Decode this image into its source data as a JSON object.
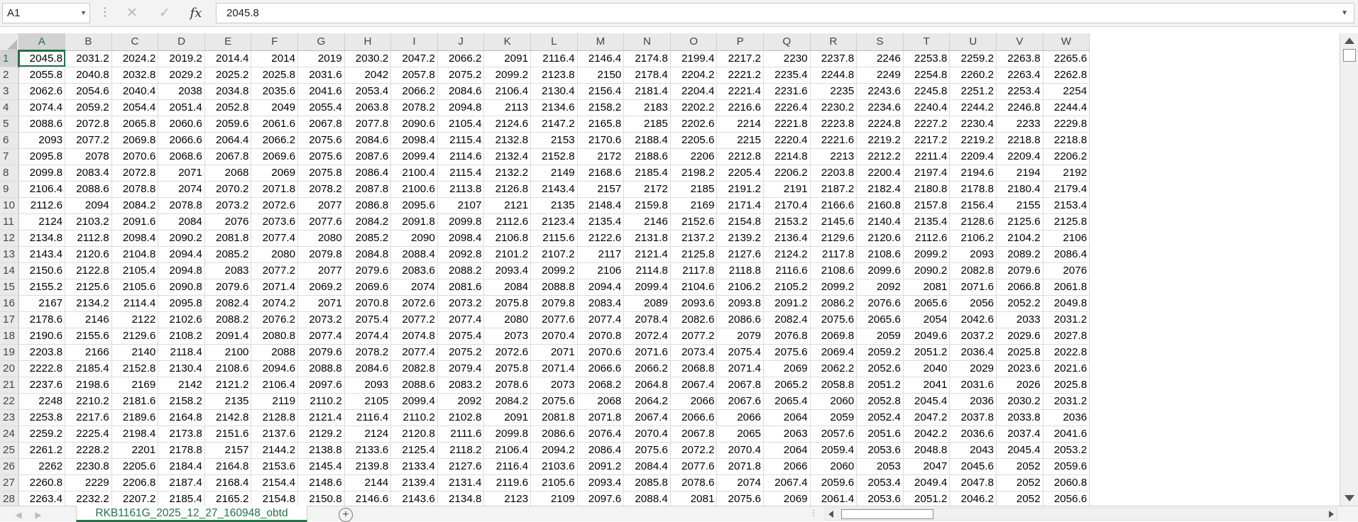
{
  "formula_bar": {
    "name_box": "A1",
    "formula_value": "2045.8",
    "cancel_icon": "close-icon",
    "enter_icon": "check-icon",
    "function_label": "fx"
  },
  "sheet": {
    "columns": [
      "A",
      "B",
      "C",
      "D",
      "E",
      "F",
      "G",
      "H",
      "I",
      "J",
      "K",
      "L",
      "M",
      "N",
      "O",
      "P",
      "Q",
      "R",
      "S",
      "T",
      "U",
      "V",
      "W"
    ],
    "selected_column": "A",
    "selected_row": 1,
    "rows": [
      {
        "n": "1",
        "cells": [
          "2045.8",
          "2031.2",
          "2024.2",
          "2019.2",
          "2014.4",
          "2014",
          "2019",
          "2030.2",
          "2047.2",
          "2066.2",
          "2091",
          "2116.4",
          "2146.4",
          "2174.8",
          "2199.4",
          "2217.2",
          "2230",
          "2237.8",
          "2246",
          "2253.8",
          "2259.2",
          "2263.8",
          "2265.6"
        ]
      },
      {
        "n": "2",
        "cells": [
          "2055.8",
          "2040.8",
          "2032.8",
          "2029.2",
          "2025.2",
          "2025.8",
          "2031.6",
          "2042",
          "2057.8",
          "2075.2",
          "2099.2",
          "2123.8",
          "2150",
          "2178.4",
          "2204.2",
          "2221.2",
          "2235.4",
          "2244.8",
          "2249",
          "2254.8",
          "2260.2",
          "2263.4",
          "2262.8"
        ]
      },
      {
        "n": "3",
        "cells": [
          "2062.6",
          "2054.6",
          "2040.4",
          "2038",
          "2034.8",
          "2035.6",
          "2041.6",
          "2053.4",
          "2066.2",
          "2084.6",
          "2106.4",
          "2130.4",
          "2156.4",
          "2181.4",
          "2204.4",
          "2221.4",
          "2231.6",
          "2235",
          "2243.6",
          "2245.8",
          "2251.2",
          "2253.4",
          "2254"
        ]
      },
      {
        "n": "4",
        "cells": [
          "2074.4",
          "2059.2",
          "2054.4",
          "2051.4",
          "2052.8",
          "2049",
          "2055.4",
          "2063.8",
          "2078.2",
          "2094.8",
          "2113",
          "2134.6",
          "2158.2",
          "2183",
          "2202.2",
          "2216.6",
          "2226.4",
          "2230.2",
          "2234.6",
          "2240.4",
          "2244.2",
          "2246.8",
          "2244.4"
        ]
      },
      {
        "n": "5",
        "cells": [
          "2088.6",
          "2072.8",
          "2065.8",
          "2060.6",
          "2059.6",
          "2061.6",
          "2067.8",
          "2077.8",
          "2090.6",
          "2105.4",
          "2124.6",
          "2147.2",
          "2165.8",
          "2185",
          "2202.6",
          "2214",
          "2221.8",
          "2223.8",
          "2224.8",
          "2227.2",
          "2230.4",
          "2233",
          "2229.8"
        ]
      },
      {
        "n": "6",
        "cells": [
          "2093",
          "2077.2",
          "2069.8",
          "2066.6",
          "2064.4",
          "2066.2",
          "2075.6",
          "2084.6",
          "2098.4",
          "2115.4",
          "2132.8",
          "2153",
          "2170.6",
          "2188.4",
          "2205.6",
          "2215",
          "2220.4",
          "2221.6",
          "2219.2",
          "2217.2",
          "2219.2",
          "2218.8",
          "2218.8"
        ]
      },
      {
        "n": "7",
        "cells": [
          "2095.8",
          "2078",
          "2070.6",
          "2068.6",
          "2067.8",
          "2069.6",
          "2075.6",
          "2087.6",
          "2099.4",
          "2114.6",
          "2132.4",
          "2152.8",
          "2172",
          "2188.6",
          "2206",
          "2212.8",
          "2214.8",
          "2213",
          "2212.2",
          "2211.4",
          "2209.4",
          "2209.4",
          "2206.2"
        ]
      },
      {
        "n": "8",
        "cells": [
          "2099.8",
          "2083.4",
          "2072.8",
          "2071",
          "2068",
          "2069",
          "2075.8",
          "2086.4",
          "2100.4",
          "2115.4",
          "2132.2",
          "2149",
          "2168.6",
          "2185.4",
          "2198.2",
          "2205.4",
          "2206.2",
          "2203.8",
          "2200.4",
          "2197.4",
          "2194.6",
          "2194",
          "2192"
        ]
      },
      {
        "n": "9",
        "cells": [
          "2106.4",
          "2088.6",
          "2078.8",
          "2074",
          "2070.2",
          "2071.8",
          "2078.2",
          "2087.8",
          "2100.6",
          "2113.8",
          "2126.8",
          "2143.4",
          "2157",
          "2172",
          "2185",
          "2191.2",
          "2191",
          "2187.2",
          "2182.4",
          "2180.8",
          "2178.8",
          "2180.4",
          "2179.4"
        ]
      },
      {
        "n": "10",
        "cells": [
          "2112.6",
          "2094",
          "2084.2",
          "2078.8",
          "2073.2",
          "2072.6",
          "2077",
          "2086.8",
          "2095.6",
          "2107",
          "2121",
          "2135",
          "2148.4",
          "2159.8",
          "2169",
          "2171.4",
          "2170.4",
          "2166.6",
          "2160.8",
          "2157.8",
          "2156.4",
          "2155",
          "2153.4"
        ]
      },
      {
        "n": "11",
        "cells": [
          "2124",
          "2103.2",
          "2091.6",
          "2084",
          "2076",
          "2073.6",
          "2077.6",
          "2084.2",
          "2091.8",
          "2099.8",
          "2112.6",
          "2123.4",
          "2135.4",
          "2146",
          "2152.6",
          "2154.8",
          "2153.2",
          "2145.6",
          "2140.4",
          "2135.4",
          "2128.6",
          "2125.6",
          "2125.8"
        ]
      },
      {
        "n": "12",
        "cells": [
          "2134.8",
          "2112.8",
          "2098.4",
          "2090.2",
          "2081.8",
          "2077.4",
          "2080",
          "2085.2",
          "2090",
          "2098.4",
          "2106.8",
          "2115.6",
          "2122.6",
          "2131.8",
          "2137.2",
          "2139.2",
          "2136.4",
          "2129.6",
          "2120.6",
          "2112.6",
          "2106.2",
          "2104.2",
          "2106"
        ]
      },
      {
        "n": "13",
        "cells": [
          "2143.4",
          "2120.6",
          "2104.8",
          "2094.4",
          "2085.2",
          "2080",
          "2079.8",
          "2084.8",
          "2088.4",
          "2092.8",
          "2101.2",
          "2107.2",
          "2117",
          "2121.4",
          "2125.8",
          "2127.6",
          "2124.2",
          "2117.8",
          "2108.6",
          "2099.2",
          "2093",
          "2089.2",
          "2086.4"
        ]
      },
      {
        "n": "14",
        "cells": [
          "2150.6",
          "2122.8",
          "2105.4",
          "2094.8",
          "2083",
          "2077.2",
          "2077",
          "2079.6",
          "2083.6",
          "2088.2",
          "2093.4",
          "2099.2",
          "2106",
          "2114.8",
          "2117.8",
          "2118.8",
          "2116.6",
          "2108.6",
          "2099.6",
          "2090.2",
          "2082.8",
          "2079.6",
          "2076"
        ]
      },
      {
        "n": "15",
        "cells": [
          "2155.2",
          "2125.6",
          "2105.6",
          "2090.8",
          "2079.6",
          "2071.4",
          "2069.2",
          "2069.6",
          "2074",
          "2081.6",
          "2084",
          "2088.8",
          "2094.4",
          "2099.4",
          "2104.6",
          "2106.2",
          "2105.2",
          "2099.2",
          "2092",
          "2081",
          "2071.6",
          "2066.8",
          "2061.8"
        ]
      },
      {
        "n": "16",
        "cells": [
          "2167",
          "2134.2",
          "2114.4",
          "2095.8",
          "2082.4",
          "2074.2",
          "2071",
          "2070.8",
          "2072.6",
          "2073.2",
          "2075.8",
          "2079.8",
          "2083.4",
          "2089",
          "2093.6",
          "2093.8",
          "2091.2",
          "2086.2",
          "2076.6",
          "2065.6",
          "2056",
          "2052.2",
          "2049.8"
        ]
      },
      {
        "n": "17",
        "cells": [
          "2178.6",
          "2146",
          "2122",
          "2102.6",
          "2088.2",
          "2076.2",
          "2073.2",
          "2075.4",
          "2077.2",
          "2077.4",
          "2080",
          "2077.6",
          "2077.4",
          "2078.4",
          "2082.6",
          "2086.6",
          "2082.4",
          "2075.6",
          "2065.6",
          "2054",
          "2042.6",
          "2033",
          "2031.2"
        ]
      },
      {
        "n": "18",
        "cells": [
          "2190.6",
          "2155.6",
          "2129.6",
          "2108.2",
          "2091.4",
          "2080.8",
          "2077.4",
          "2074.4",
          "2074.8",
          "2075.4",
          "2073",
          "2070.4",
          "2070.8",
          "2072.4",
          "2077.2",
          "2079",
          "2076.8",
          "2069.8",
          "2059",
          "2049.6",
          "2037.2",
          "2029.6",
          "2027.8"
        ]
      },
      {
        "n": "19",
        "cells": [
          "2203.8",
          "2166",
          "2140",
          "2118.4",
          "2100",
          "2088",
          "2079.6",
          "2078.2",
          "2077.4",
          "2075.2",
          "2072.6",
          "2071",
          "2070.6",
          "2071.6",
          "2073.4",
          "2075.4",
          "2075.6",
          "2069.4",
          "2059.2",
          "2051.2",
          "2036.4",
          "2025.8",
          "2022.8"
        ]
      },
      {
        "n": "20",
        "cells": [
          "2222.8",
          "2185.4",
          "2152.8",
          "2130.4",
          "2108.6",
          "2094.6",
          "2088.8",
          "2084.6",
          "2082.8",
          "2079.4",
          "2075.8",
          "2071.4",
          "2066.6",
          "2066.2",
          "2068.8",
          "2071.4",
          "2069",
          "2062.2",
          "2052.6",
          "2040",
          "2029",
          "2023.6",
          "2021.6"
        ]
      },
      {
        "n": "21",
        "cells": [
          "2237.6",
          "2198.6",
          "2169",
          "2142",
          "2121.2",
          "2106.4",
          "2097.6",
          "2093",
          "2088.6",
          "2083.2",
          "2078.6",
          "2073",
          "2068.2",
          "2064.8",
          "2067.4",
          "2067.8",
          "2065.2",
          "2058.8",
          "2051.2",
          "2041",
          "2031.6",
          "2026",
          "2025.8"
        ]
      },
      {
        "n": "22",
        "cells": [
          "2248",
          "2210.2",
          "2181.6",
          "2158.2",
          "2135",
          "2119",
          "2110.2",
          "2105",
          "2099.4",
          "2092",
          "2084.2",
          "2075.6",
          "2068",
          "2064.2",
          "2066",
          "2067.6",
          "2065.4",
          "2060",
          "2052.8",
          "2045.4",
          "2036",
          "2030.2",
          "2031.2"
        ]
      },
      {
        "n": "23",
        "cells": [
          "2253.8",
          "2217.6",
          "2189.6",
          "2164.8",
          "2142.8",
          "2128.8",
          "2121.4",
          "2116.4",
          "2110.2",
          "2102.8",
          "2091",
          "2081.8",
          "2071.8",
          "2067.4",
          "2066.6",
          "2066",
          "2064",
          "2059",
          "2052.4",
          "2047.2",
          "2037.8",
          "2033.8",
          "2036"
        ]
      },
      {
        "n": "24",
        "cells": [
          "2259.2",
          "2225.4",
          "2198.4",
          "2173.8",
          "2151.6",
          "2137.6",
          "2129.2",
          "2124",
          "2120.8",
          "2111.6",
          "2099.8",
          "2086.6",
          "2076.4",
          "2070.4",
          "2067.8",
          "2065",
          "2063",
          "2057.6",
          "2051.6",
          "2042.2",
          "2036.6",
          "2037.4",
          "2041.6"
        ]
      },
      {
        "n": "25",
        "cells": [
          "2261.2",
          "2228.2",
          "2201",
          "2178.8",
          "2157",
          "2144.2",
          "2138.8",
          "2133.6",
          "2125.4",
          "2118.2",
          "2106.4",
          "2094.2",
          "2086.4",
          "2075.6",
          "2072.2",
          "2070.4",
          "2064",
          "2059.4",
          "2053.6",
          "2048.8",
          "2043",
          "2045.4",
          "2053.2"
        ]
      },
      {
        "n": "26",
        "cells": [
          "2262",
          "2230.8",
          "2205.6",
          "2184.4",
          "2164.8",
          "2153.6",
          "2145.4",
          "2139.8",
          "2133.4",
          "2127.6",
          "2116.4",
          "2103.6",
          "2091.2",
          "2084.4",
          "2077.6",
          "2071.8",
          "2066",
          "2060",
          "2053",
          "2047",
          "2045.6",
          "2052",
          "2059.6"
        ]
      },
      {
        "n": "27",
        "cells": [
          "2260.8",
          "2229",
          "2206.8",
          "2187.4",
          "2168.4",
          "2154.4",
          "2148.6",
          "2144",
          "2139.4",
          "2131.4",
          "2119.6",
          "2105.6",
          "2093.4",
          "2085.8",
          "2078.6",
          "2074",
          "2067.4",
          "2059.6",
          "2053.4",
          "2049.4",
          "2047.8",
          "2052",
          "2060.8"
        ]
      },
      {
        "n": "28",
        "cells": [
          "2263.4",
          "2232.2",
          "2207.2",
          "2185.4",
          "2165.2",
          "2154.8",
          "2150.8",
          "2146.6",
          "2143.6",
          "2134.8",
          "2123",
          "2109",
          "2097.6",
          "2088.4",
          "2081",
          "2075.6",
          "2069",
          "2061.4",
          "2053.6",
          "2051.2",
          "2046.2",
          "2052",
          "2056.6"
        ]
      }
    ]
  },
  "sheet_tabs": {
    "active_tab": "RKB1161G_2025_12_27_160948_obtd",
    "add_sheet_icon": "plus-circle-icon"
  },
  "colors": {
    "accent": "#217346",
    "header_bg": "#e9e9e9",
    "gridline": "#dadcdd"
  }
}
